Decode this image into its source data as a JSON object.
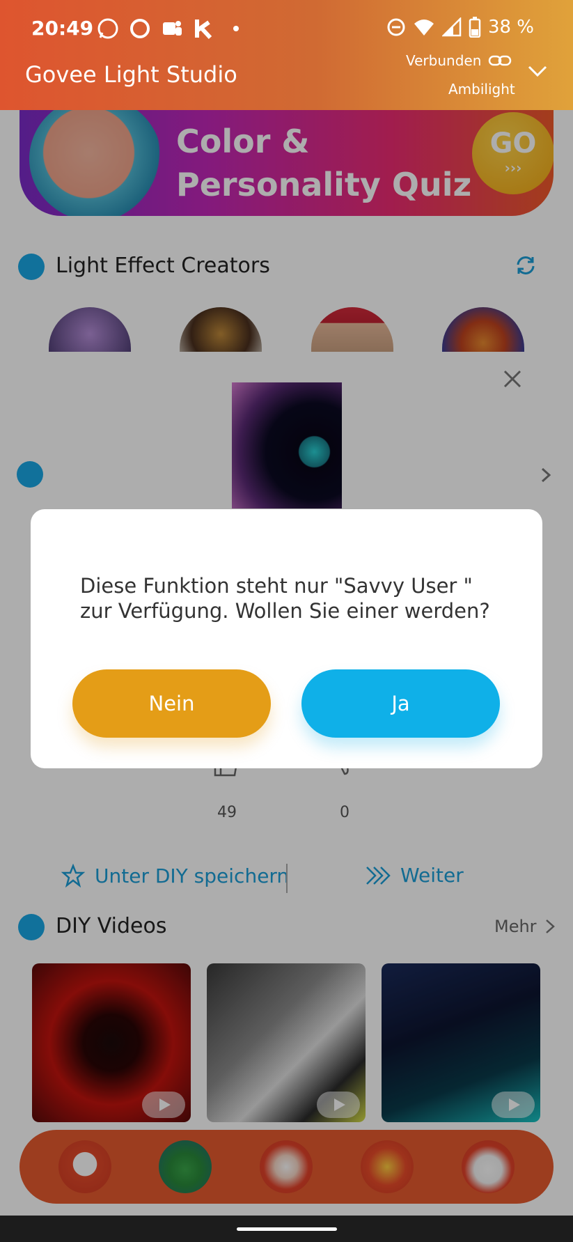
{
  "status_bar": {
    "time": "20:49",
    "battery": "38 %",
    "left_icons": [
      "whatsapp-icon",
      "circle-app-icon",
      "teams-icon",
      "k-app-icon",
      "dot-icon"
    ],
    "right_icons": [
      "dnd-icon",
      "wifi-icon",
      "signal-icon",
      "battery-icon"
    ]
  },
  "header": {
    "app_title": "Govee Light Studio",
    "connection_status": "Verbunden",
    "device_name": "Ambilight"
  },
  "banner": {
    "line1": "Color &",
    "line2": "Personality Quiz",
    "go_label": "GO",
    "go_arrows": "›››"
  },
  "creators_section": {
    "title": "Light Effect Creators",
    "creator_count": 4
  },
  "effect_detail": {
    "likes": "49",
    "dislikes": "0",
    "save_label": "Unter DIY speichern",
    "next_label": "Weiter"
  },
  "videos_section": {
    "title": "DIY Videos",
    "more_label": "Mehr",
    "video_count": 3
  },
  "dialog": {
    "message": "Diese Funktion steht nur \"Savvy User \" zur Verfügung. Wollen Sie einer werden?",
    "no_label": "Nein",
    "yes_label": "Ja"
  },
  "bottom_nav": {
    "items": [
      "house-icon",
      "christmas-tree-icon",
      "santa-icon",
      "gift-cake-icon",
      "snowman-icon"
    ]
  },
  "colors": {
    "header_start": "#de552f",
    "header_end": "#e0a23a",
    "accent_blue": "#1b9ed8",
    "button_no": "#e49d17",
    "button_yes": "#0fb0e8",
    "nav_bg": "#e65a2f"
  }
}
